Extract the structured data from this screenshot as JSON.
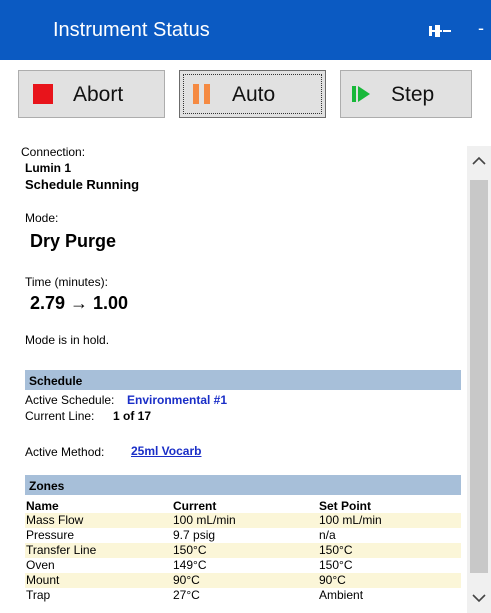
{
  "window": {
    "title": "Instrument Status",
    "pin_glyph": "pin",
    "more_glyph": "-"
  },
  "toolbar": {
    "abort_label": "Abort",
    "auto_label": "Auto",
    "step_label": "Step"
  },
  "status": {
    "connection_label": "Connection:",
    "instrument": "Lumin 1",
    "schedule_state": "Schedule Running",
    "mode_label": "Mode:",
    "mode": "Dry Purge",
    "time_label": "Time (minutes):",
    "time_value": "2.79 → 1.00",
    "hold_message": "Mode is in hold."
  },
  "schedule": {
    "header": "Schedule",
    "active_schedule_label": "Active Schedule:",
    "active_schedule_value": "Environmental #1",
    "current_line_label": "Current Line:",
    "current_line_value": "1 of 17",
    "active_method_label": "Active Method:",
    "active_method_value": "25ml Vocarb"
  },
  "zones": {
    "header": "Zones",
    "columns": [
      "Name",
      "Current",
      "Set Point"
    ],
    "rows": [
      [
        "Mass Flow",
        "100 mL/min",
        "100 mL/min"
      ],
      [
        "Pressure",
        "9.7 psig",
        "n/a"
      ],
      [
        "Transfer Line",
        "150°C",
        "150°C"
      ],
      [
        "Oven",
        "149°C",
        "150°C"
      ],
      [
        "Mount",
        "90°C",
        "90°C"
      ],
      [
        "Trap",
        "27°C",
        "Ambient"
      ]
    ]
  },
  "colors": {
    "titlebar": "#0b5ac2",
    "section_header": "#a7bfd9",
    "zebra_row": "#fbf6d8",
    "abort_icon": "#e8141b",
    "pause_icon": "#f58a42",
    "step_icon": "#18b83a",
    "link": "#1a2ec7"
  },
  "icons": {
    "abort": "stop-square-icon",
    "auto": "pause-icon",
    "step": "step-play-icon",
    "pin": "pin-icon",
    "scroll_up": "chevron-up-icon",
    "scroll_down": "chevron-down-icon"
  }
}
